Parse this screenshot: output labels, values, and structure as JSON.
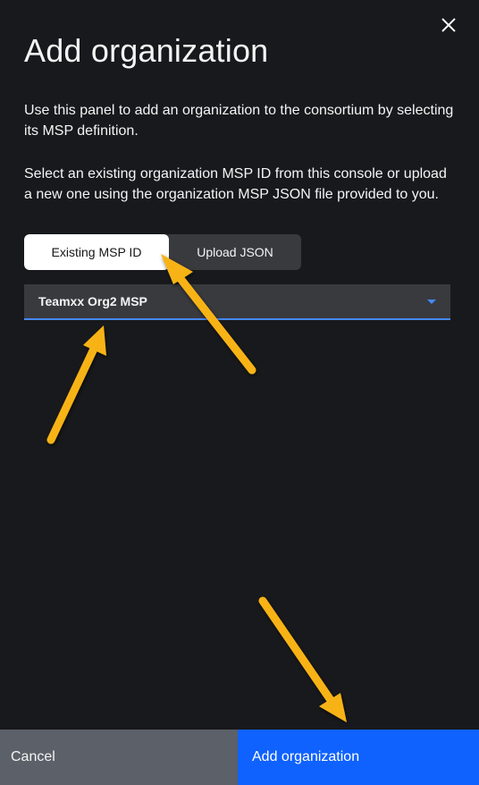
{
  "panel": {
    "title": "Add organization",
    "description_1": "Use this panel to add an organization to the consortium by selecting its MSP definition.",
    "description_2": "Select an existing organization MSP ID from this console or upload a new one using the organization MSP JSON file provided to you."
  },
  "switcher": {
    "options": [
      {
        "label": "Existing MSP ID",
        "selected": true
      },
      {
        "label": "Upload JSON",
        "selected": false
      }
    ]
  },
  "msp_select": {
    "value": "Teamxx Org2 MSP"
  },
  "footer": {
    "cancel_label": "Cancel",
    "submit_label": "Add organization"
  },
  "icons": {
    "close": "close-icon",
    "caret": "chevron-down-icon"
  },
  "colors": {
    "background": "#18191c",
    "primary": "#0f62fe",
    "accent": "#4589ff",
    "cancel": "#5c6068",
    "annotation_arrow": "#f7b318"
  }
}
